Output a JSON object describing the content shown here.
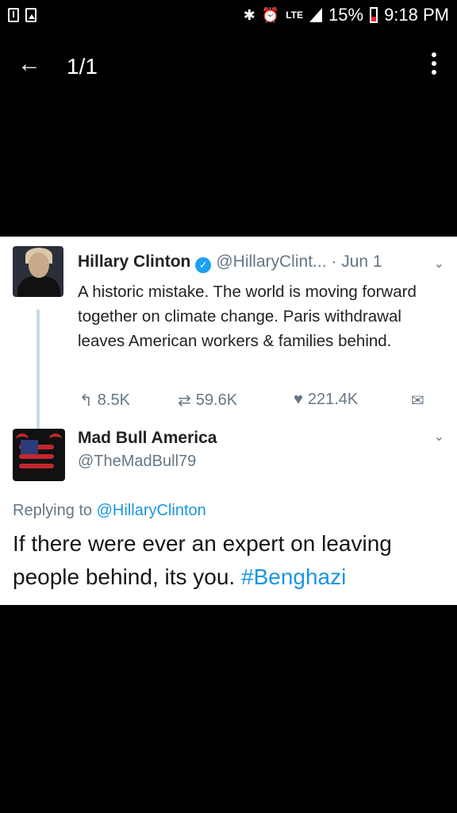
{
  "status_bar": {
    "lte": "LTE",
    "battery": "15%",
    "time": "9:18 PM",
    "icons": [
      "alert-icon",
      "image-icon",
      "bluetooth-icon",
      "alarm-icon",
      "signal-icon",
      "battery-icon"
    ],
    "battery_color": "#e23"
  },
  "app_bar": {
    "counter": "1/1",
    "icons": [
      "back-arrow-icon",
      "more-vert-icon"
    ]
  },
  "tweet1": {
    "name": "Hillary Clinton",
    "handle": "@HillaryClint...",
    "separator": "·",
    "date": "Jun 1",
    "text": "A historic mistake. The world is moving forward together on climate change. Paris withdrawal leaves American workers & families behind.",
    "replies": "8.5K",
    "retweets": "59.6K",
    "likes": "221.4K",
    "icons": [
      "verified-badge-icon",
      "reply-icon",
      "retweet-icon",
      "heart-icon",
      "message-icon",
      "chevron-down-icon"
    ]
  },
  "tweet2": {
    "name": "Mad Bull America",
    "handle": "@TheMadBull79",
    "reply_prefix": "Replying to",
    "reply_to": "@HillaryClinton",
    "text": "If there were ever an expert on leaving people behind, its you.",
    "hashtag": "#Benghazi",
    "icons": [
      "chevron-down-icon"
    ]
  },
  "colors": {
    "link": "#1b95e0",
    "muted": "#657786",
    "verified": "#1da1f2",
    "thread_line": "#c8dbe9"
  }
}
